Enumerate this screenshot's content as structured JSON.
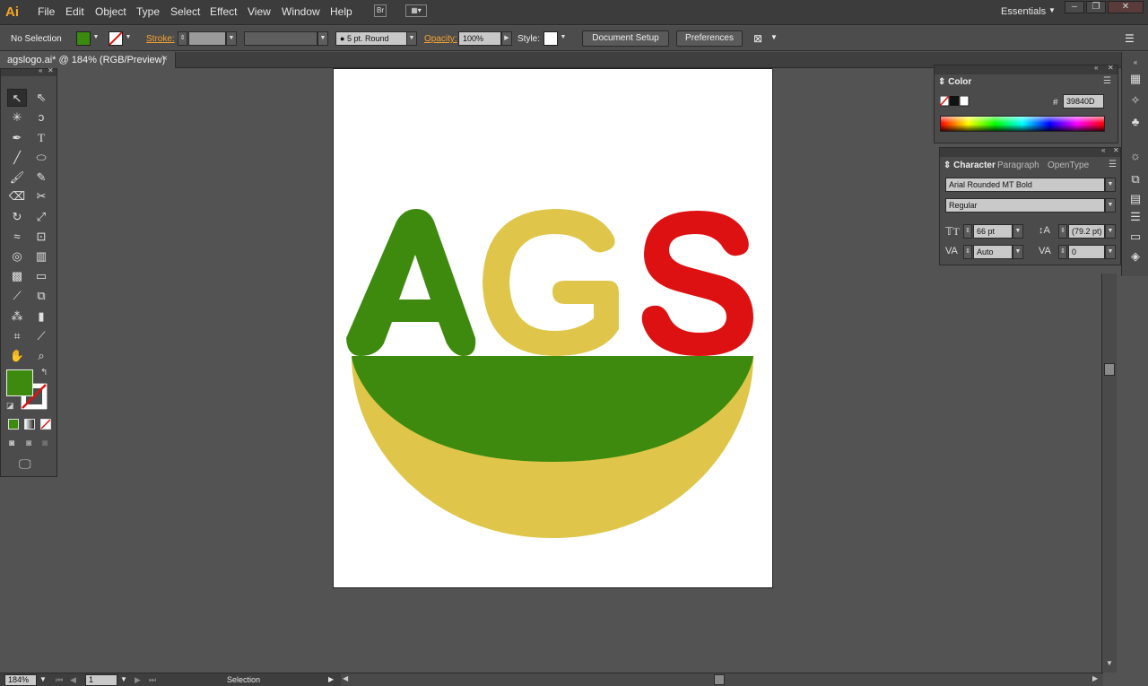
{
  "app": {
    "logo": "Ai",
    "workspace": "Essentials"
  },
  "menu": [
    "File",
    "Edit",
    "Object",
    "Type",
    "Select",
    "Effect",
    "View",
    "Window",
    "Help"
  ],
  "control_bar": {
    "selection": "No Selection",
    "stroke_label": "Stroke:",
    "brush": "5 pt. Round",
    "opacity_label": "Opacity:",
    "opacity_value": "100%",
    "style_label": "Style:",
    "document_setup": "Document Setup",
    "preferences": "Preferences",
    "fill_color": "#3a8a0f"
  },
  "document_tab": {
    "label": "agslogo.ai* @ 184% (RGB/Preview)",
    "close": "×"
  },
  "logo": {
    "letters": [
      "A",
      "G",
      "S"
    ],
    "colors": {
      "green": "#3d8a0e",
      "yellow": "#dfc64a",
      "red": "#dd1111"
    }
  },
  "color_panel": {
    "title": "Color",
    "hex_prefix": "#",
    "hex_value": "39840D"
  },
  "character_panel": {
    "tabs": [
      "Character",
      "Paragraph",
      "OpenType"
    ],
    "font_family": "Arial Rounded MT Bold",
    "font_style": "Regular",
    "font_size": "66 pt",
    "leading": "(79.2 pt)",
    "kerning": "Auto",
    "tracking": "0"
  },
  "status_bar": {
    "zoom": "184%",
    "artboard": "1",
    "tool": "Selection"
  }
}
